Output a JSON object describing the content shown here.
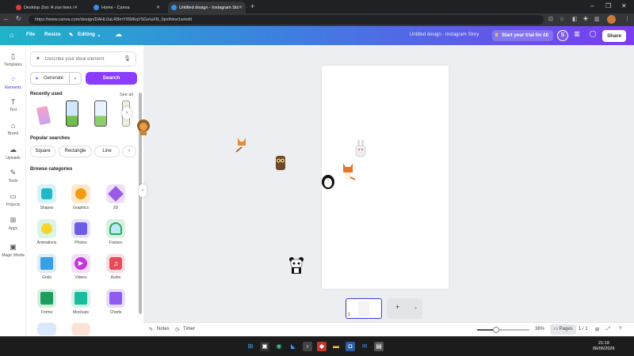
{
  "browser": {
    "tabs": [
      {
        "label": "Desktop Zoo: A zoo lives on your...",
        "favicon_color": "#e53935"
      },
      {
        "label": "Home - Canva",
        "favicon_color": "#3b8ee8"
      },
      {
        "label": "Untitled design - Instagram Story",
        "favicon_color": "#3b8ee8"
      }
    ],
    "url": "https://www.canva.com/design/DAHL0aLR8mY/0M6qVSGxIaXN_0pxifxkw1w/edit"
  },
  "header": {
    "file": "File",
    "resize": "Resize",
    "editing": "Editing",
    "doc_title": "Untitled design - Instagram Story",
    "trial": "Start your trial for £0",
    "avatar": "S",
    "share": "Share"
  },
  "rail": {
    "items": [
      {
        "label": "Templates",
        "icon": "▯"
      },
      {
        "label": "Elements",
        "icon": "⁘"
      },
      {
        "label": "Text",
        "icon": "T"
      },
      {
        "label": "Brand",
        "icon": "⌂"
      },
      {
        "label": "Uploads",
        "icon": "☁"
      },
      {
        "label": "Tools",
        "icon": "✎"
      },
      {
        "label": "Projects",
        "icon": "▭"
      },
      {
        "label": "Apps",
        "icon": "⊞"
      },
      {
        "label": "Magic Media",
        "icon": "▣"
      }
    ]
  },
  "panel": {
    "search_placeholder": "Describe your ideal element",
    "generate": "Generate",
    "search_button": "Search",
    "recently_used": "Recently used",
    "see_all": "See all",
    "popular_searches": "Popular searches",
    "popular": [
      "Square",
      "Rectangle",
      "Line"
    ],
    "browse_categories": "Browse categories",
    "categories": [
      {
        "label": "Shapes",
        "color": "#22b8c9"
      },
      {
        "label": "Graphics",
        "color": "#f39c12"
      },
      {
        "label": "3D",
        "color": "#9b59e6"
      },
      {
        "label": "Animations",
        "color": "#2ecc71"
      },
      {
        "label": "Photos",
        "color": "#6c5ce7"
      },
      {
        "label": "Frames",
        "color": "#27ae60"
      },
      {
        "label": "Grids",
        "color": "#3aa0e6"
      },
      {
        "label": "Videos",
        "color": "#c03ad8"
      },
      {
        "label": "Audio",
        "color": "#e74c5c"
      },
      {
        "label": "Forms",
        "color": "#1e9e5e"
      },
      {
        "label": "Mockups",
        "color": "#1abc9c"
      },
      {
        "label": "Charts",
        "color": "#8e5cf0"
      }
    ]
  },
  "footer": {
    "notes": "Notes",
    "timer": "Timer",
    "zoom": "36%",
    "zoom_fraction": 0.36,
    "pages": "Pages",
    "page_count": "1 / 1",
    "thumb_number": "1"
  },
  "taskbar": {
    "time": "21:19",
    "date": "06/06/2026"
  }
}
